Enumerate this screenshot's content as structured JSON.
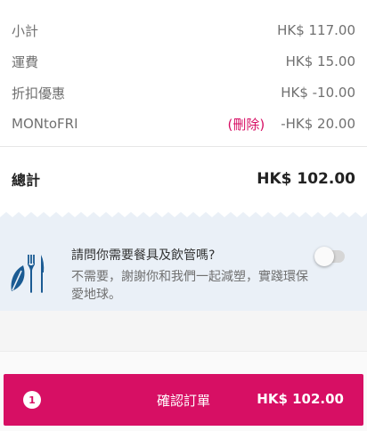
{
  "summary": {
    "subtotal_label": "小計",
    "subtotal_value": "HK$ 117.00",
    "delivery_label": "運費",
    "delivery_value": "HK$ 15.00",
    "discount_label": "折扣優惠",
    "discount_value": "HK$ -10.00",
    "voucher_label": "MONtoFRI",
    "voucher_delete": "(刪除)",
    "voucher_value": "-HK$ 20.00",
    "total_label": "總計",
    "total_value": "HK$ 102.00"
  },
  "cutlery": {
    "icon": "cutlery-leaf-icon",
    "title": "請問你需要餐具及飲管嗎?",
    "description": "不需要，謝謝你和我們一起減塑，實踐環保愛地球。",
    "toggle_on": false
  },
  "confirm": {
    "item_count": "1",
    "label": "確認訂單",
    "total": "HK$ 102.00"
  },
  "colors": {
    "accent": "#d70f64",
    "banner_bg": "#eaf0f7",
    "icon_blue": "#1b5b93"
  }
}
